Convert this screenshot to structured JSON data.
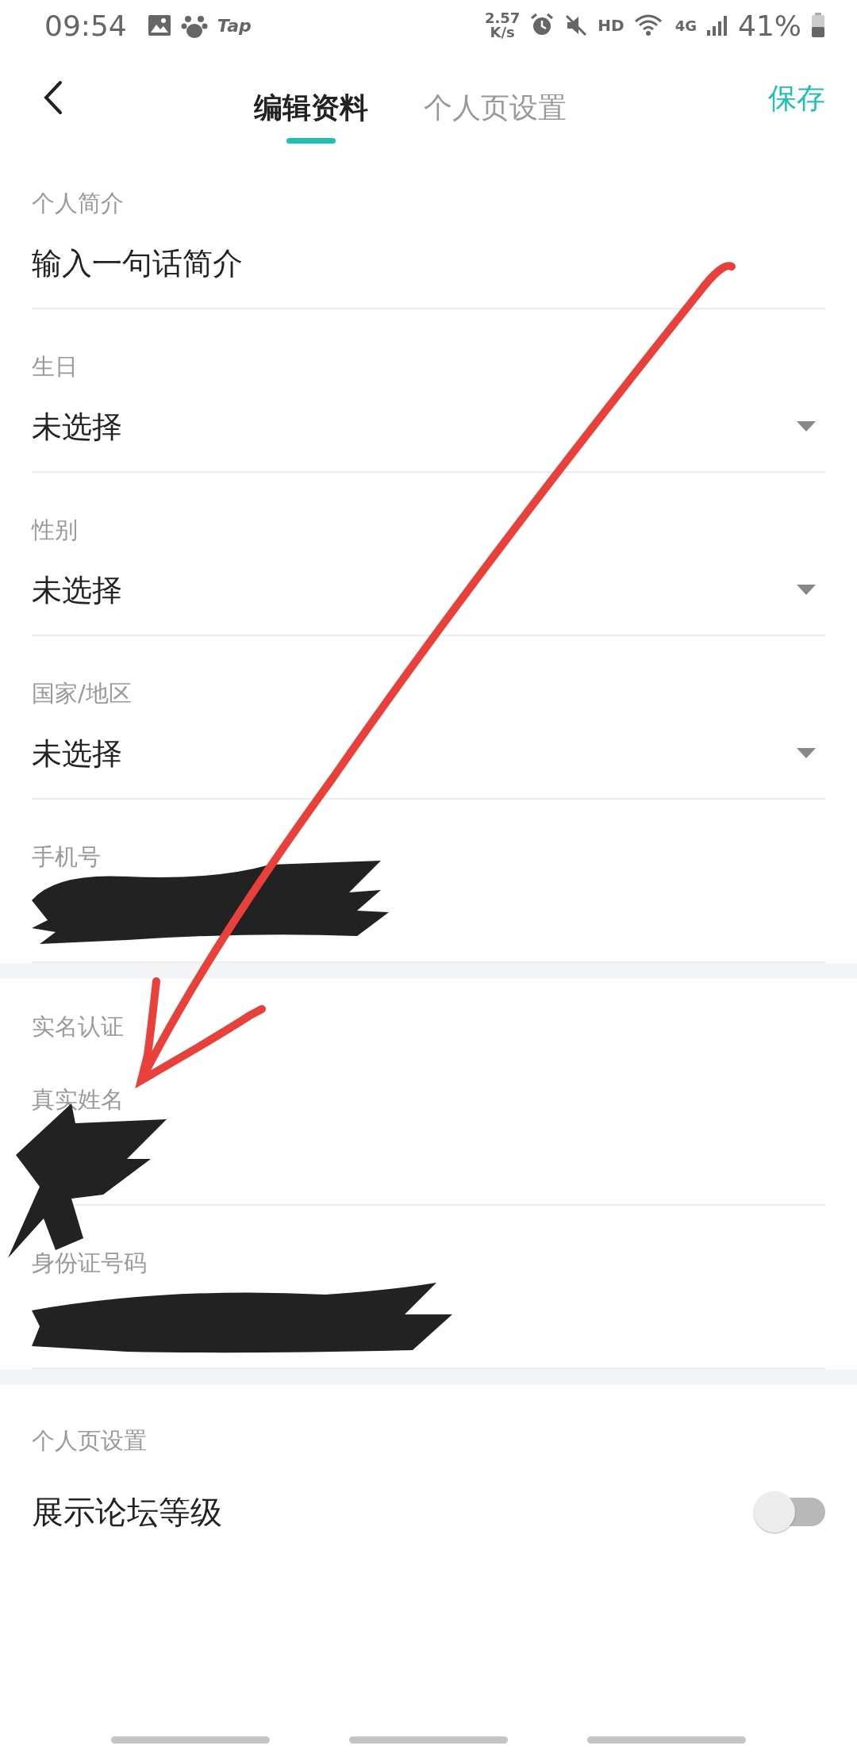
{
  "status_bar": {
    "time": "09:54",
    "app_badge": "Tap",
    "speed_value": "2.57",
    "speed_unit": "K/s",
    "hd": "HD",
    "network": "4G",
    "battery": "41%"
  },
  "header": {
    "tabs": [
      {
        "label": "编辑资料",
        "selected": true
      },
      {
        "label": "个人页设置",
        "selected": false
      }
    ],
    "save": "保存"
  },
  "profile_fields": [
    {
      "kind": "text",
      "label": "个人简介",
      "value": "输入一句话简介"
    },
    {
      "kind": "select",
      "label": "生日",
      "value": "未选择"
    },
    {
      "kind": "select",
      "label": "性别",
      "value": "未选择"
    },
    {
      "kind": "select",
      "label": "国家/地区",
      "value": "未选择"
    },
    {
      "kind": "redacted",
      "label": "手机号"
    }
  ],
  "real_name": {
    "title": "实名认证",
    "fields": [
      {
        "kind": "redacted",
        "label": "真实姓名"
      },
      {
        "kind": "redacted",
        "label": "身份证号码"
      }
    ]
  },
  "page_settings": {
    "title": "个人页设置",
    "toggle": {
      "label": "展示论坛等级",
      "on": false
    }
  },
  "annotation": {
    "kind": "arrow"
  }
}
